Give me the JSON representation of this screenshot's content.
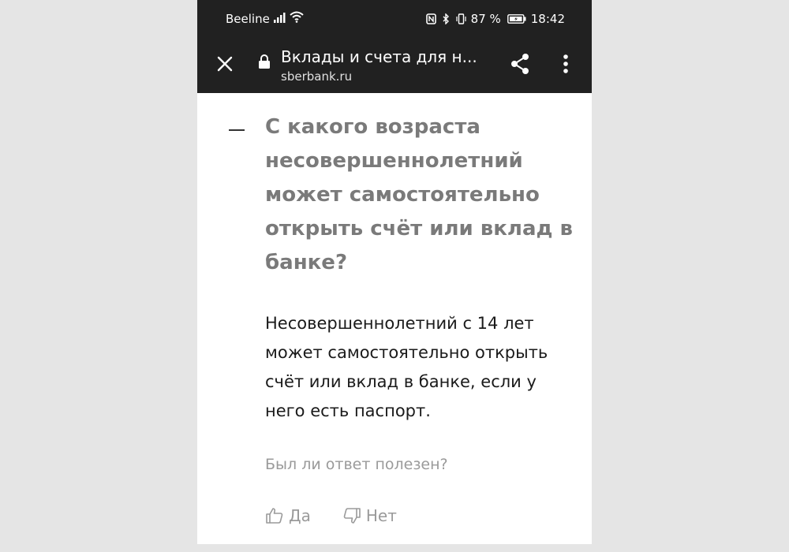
{
  "status_bar": {
    "carrier": "Beeline",
    "battery": "87 %",
    "time": "18:42",
    "icons": [
      "signal-icon",
      "wifi-icon",
      "nfc-icon",
      "bluetooth-icon",
      "vibrate-icon",
      "battery-icon"
    ]
  },
  "toolbar": {
    "title": "Вклады и счета для н...",
    "url": "sberbank.ru",
    "icons": [
      "close-icon",
      "lock-icon",
      "share-icon",
      "more-vert-icon"
    ]
  },
  "faq": {
    "question": "С какого возраста несовершеннолетний может самостоятельно открыть счёт или вклад в банке?",
    "answer": "Несовершеннолетний с 14 лет может самостоятельно открыть счёт или вклад в банке, если у него есть паспорт.",
    "feedback_question": "Был ли ответ полезен?",
    "yes_label": "Да",
    "no_label": "Нет"
  },
  "colors": {
    "bar_background": "#212121",
    "question_text": "#7a7a7a",
    "answer_text": "#1a1a1a",
    "muted_text": "#9a9a9a"
  }
}
